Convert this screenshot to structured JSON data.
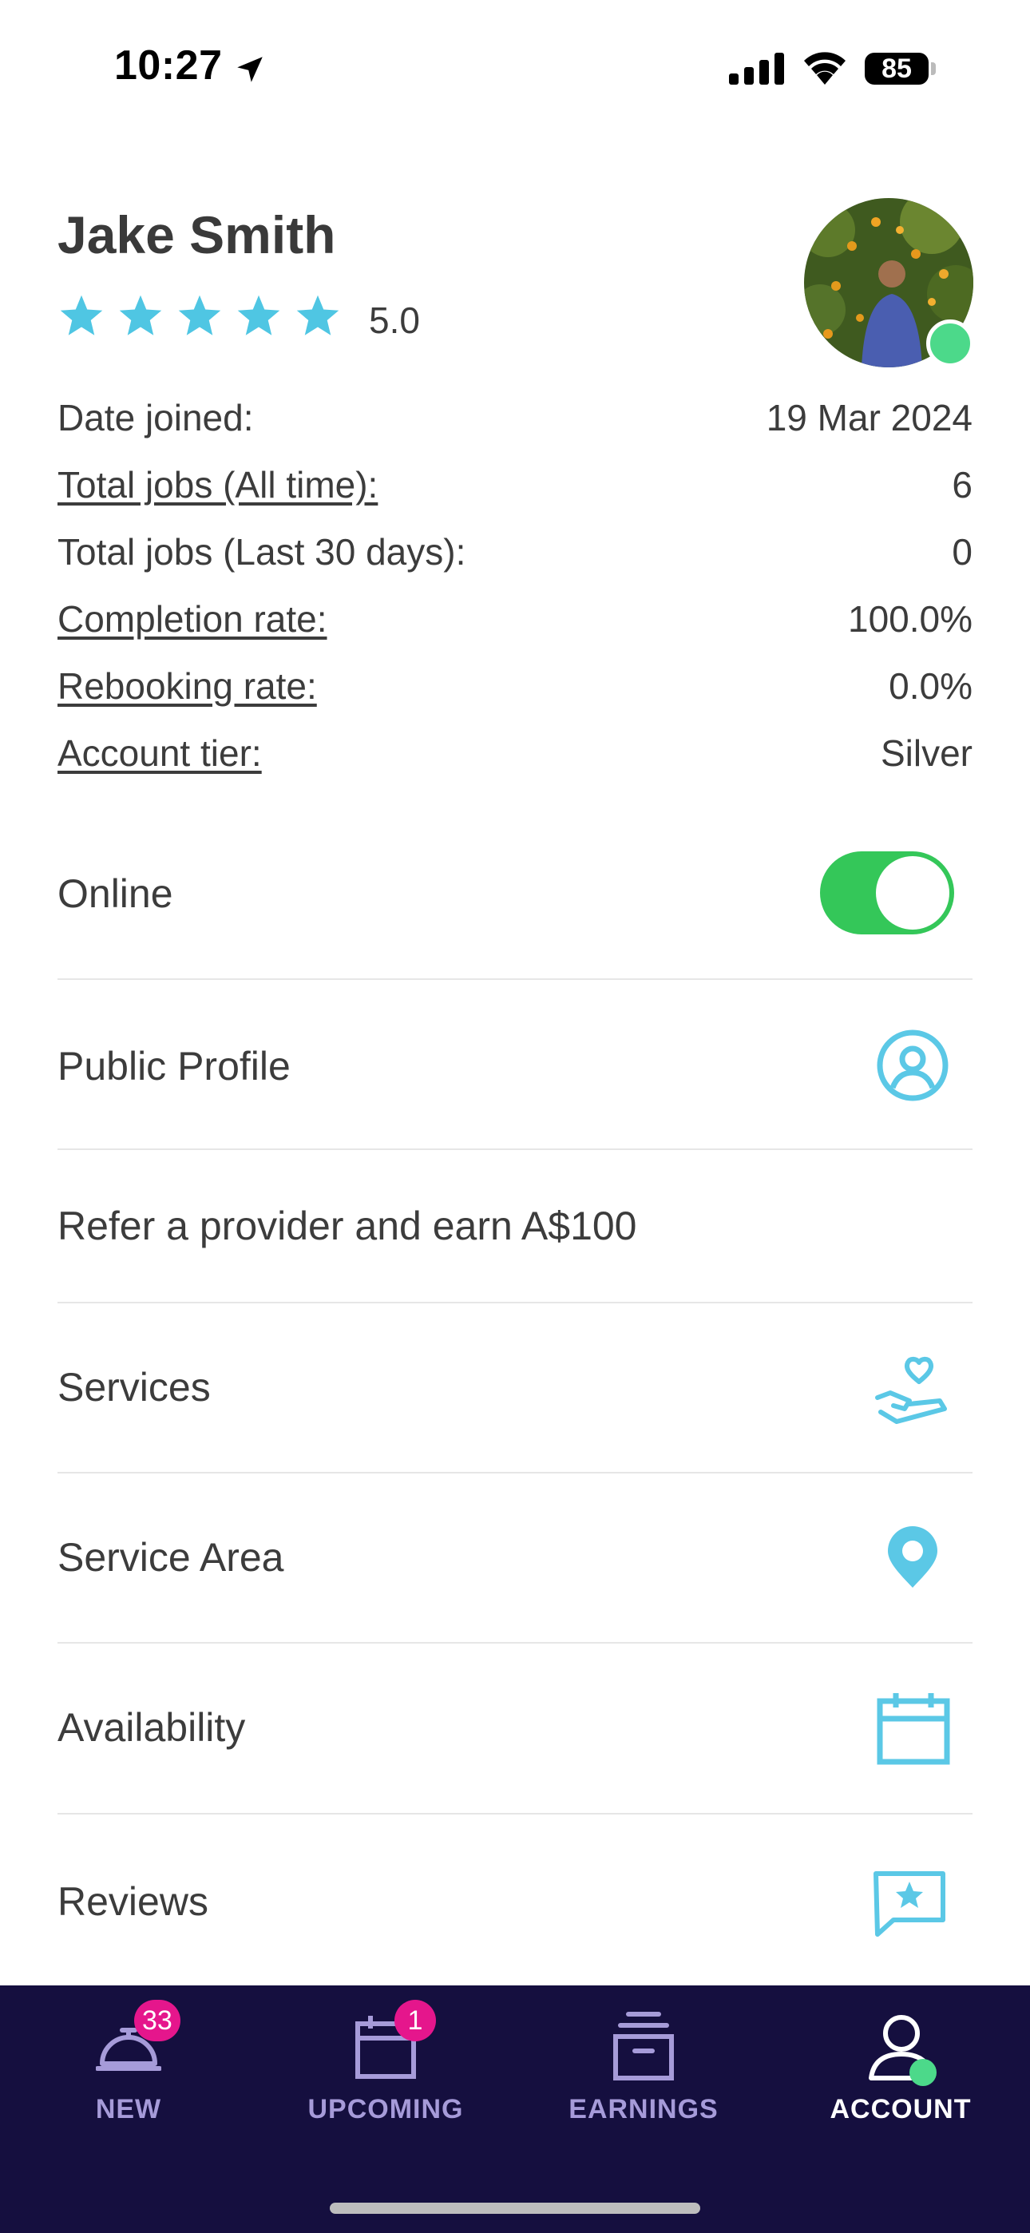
{
  "status_bar": {
    "time": "10:27",
    "battery": "85"
  },
  "profile": {
    "name": "Jake Smith",
    "rating": "5.0",
    "stars": 5,
    "online": true
  },
  "stats": [
    {
      "label": "Date joined:",
      "value": "19 Mar 2024",
      "link": false
    },
    {
      "label": "Total jobs (All time):",
      "value": "6",
      "link": true
    },
    {
      "label": "Total jobs (Last 30 days):",
      "value": "0",
      "link": false
    },
    {
      "label": "Completion rate:",
      "value": "100.0%",
      "link": true
    },
    {
      "label": "Rebooking rate:",
      "value": "0.0%",
      "link": true
    },
    {
      "label": "Account tier:",
      "value": "Silver",
      "link": true
    }
  ],
  "menu": {
    "online_label": "Online",
    "online_toggle": true,
    "public_profile": "Public Profile",
    "refer": "Refer a provider and earn A$100",
    "services": "Services",
    "service_area": "Service Area",
    "availability": "Availability",
    "reviews": "Reviews"
  },
  "tabs": [
    {
      "label": "NEW",
      "badge": "33",
      "icon": "bell-icon",
      "active": false
    },
    {
      "label": "UPCOMING",
      "badge": "1",
      "icon": "calendar-icon",
      "active": false
    },
    {
      "label": "EARNINGS",
      "badge": "",
      "icon": "archive-box-icon",
      "active": false
    },
    {
      "label": "ACCOUNT",
      "badge": "",
      "icon": "user-icon",
      "active": true
    }
  ],
  "colors": {
    "accent": "#5bc8e6",
    "star": "#4fc6e3",
    "toggle_on": "#34c759",
    "tab_bar_bg": "#150f3f",
    "tab_inactive": "#a69bd9",
    "badge": "#e5168c",
    "online_dot": "#4cd98a"
  }
}
